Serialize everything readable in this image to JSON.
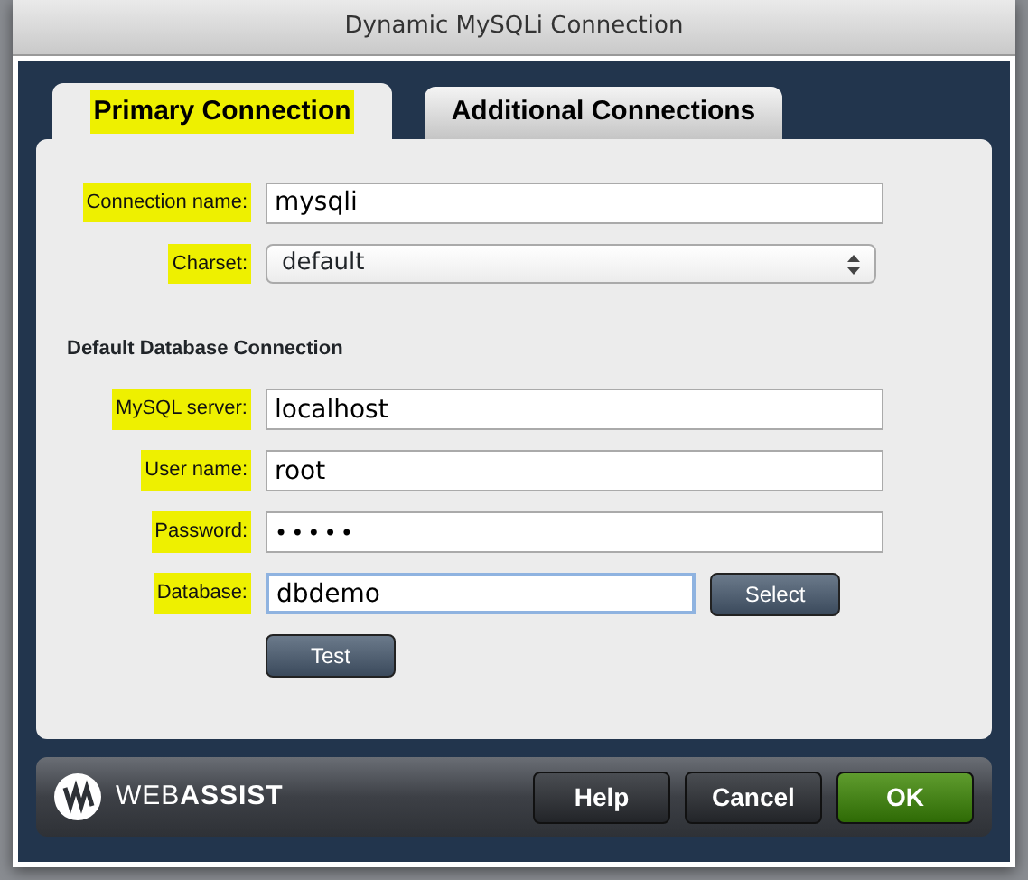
{
  "window": {
    "title": "Dynamic MySQLi Connection"
  },
  "tabs": [
    {
      "label": "Primary Connection",
      "selected": true,
      "highlighted": true
    },
    {
      "label": "Additional Connections",
      "selected": false,
      "highlighted": false
    }
  ],
  "fields": [
    {
      "label": "Connection name:",
      "kind": "text",
      "value": "mysqli",
      "highlighted": true,
      "focused": false
    },
    {
      "label": "Charset:",
      "kind": "select",
      "value": "default",
      "highlighted": true,
      "focused": false
    }
  ],
  "section": {
    "title": "Default Database Connection",
    "fields": [
      {
        "label": "MySQL server:",
        "kind": "text",
        "value": "localhost",
        "highlighted": true,
        "focused": false
      },
      {
        "label": "User name:",
        "kind": "text",
        "value": "root",
        "highlighted": true,
        "focused": false
      },
      {
        "label": "Password:",
        "kind": "password",
        "value": "•••••",
        "highlighted": true,
        "focused": false
      },
      {
        "label": "Database:",
        "kind": "text",
        "value": "dbdemo",
        "highlighted": true,
        "focused": true,
        "button": "Select"
      }
    ],
    "test_button": "Test"
  },
  "footer": {
    "logo": "WEB**ASSIST**",
    "buttons": [
      {
        "label": "Help",
        "kind": "default"
      },
      {
        "label": "Cancel",
        "kind": "default"
      },
      {
        "label": "OK",
        "kind": "primary"
      }
    ]
  }
}
